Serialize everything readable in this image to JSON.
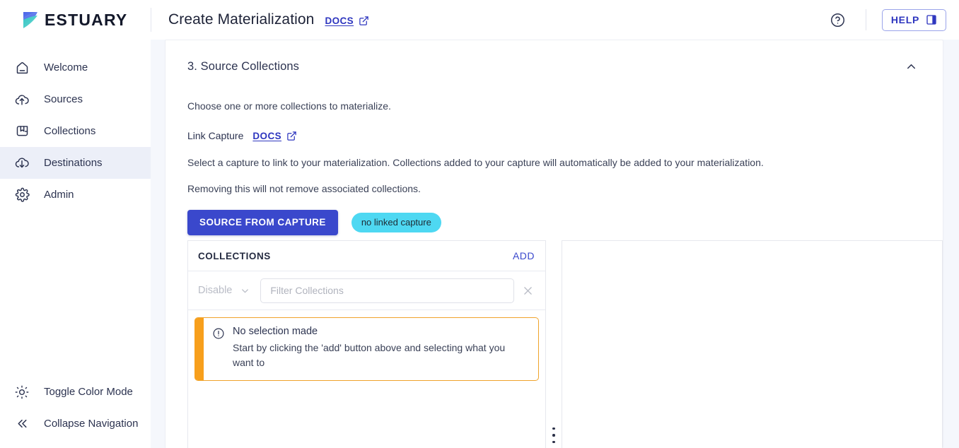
{
  "topbar": {
    "brand": "ESTUARY",
    "logo_icon": "estuary-logo-icon",
    "page_title": "Create Materialization",
    "docs_label": "DOCS",
    "docs_external_icon": "external-link-icon",
    "help_circle_icon": "help-circle-icon",
    "help_button_label": "HELP",
    "help_button_icon": "panel-open-icon"
  },
  "sidebar": {
    "items": [
      {
        "label": "Welcome",
        "icon": "home-icon",
        "active": false
      },
      {
        "label": "Sources",
        "icon": "cloud-upload-icon",
        "active": false
      },
      {
        "label": "Collections",
        "icon": "collections-icon",
        "active": false
      },
      {
        "label": "Destinations",
        "icon": "cloud-download-icon",
        "active": true
      },
      {
        "label": "Admin",
        "icon": "gear-icon",
        "active": false
      }
    ],
    "bottom_items": [
      {
        "label": "Toggle Color Mode",
        "icon": "sun-icon"
      },
      {
        "label": "Collapse Navigation",
        "icon": "chevrons-left-icon"
      }
    ]
  },
  "section": {
    "title": "3. Source Collections",
    "collapse_icon": "chevron-up-icon",
    "choose_text": "Choose one or more collections to materialize.",
    "link_capture_label": "Link Capture",
    "link_capture_docs_label": "DOCS",
    "link_capture_docs_icon": "external-link-icon",
    "select_text": "Select a capture to link to your materialization. Collections added to your capture will automatically be added to your materialization.",
    "removing_text": "Removing this will not remove associated collections.",
    "source_button_label": "SOURCE FROM CAPTURE",
    "linked_capture_chip": "no linked capture"
  },
  "collections_panel": {
    "header_title": "COLLECTIONS",
    "add_label": "ADD",
    "disable_select_value": "Disable",
    "disable_select_icon": "chevron-down-icon",
    "filter_placeholder": "Filter Collections",
    "filter_value": "",
    "clear_icon": "close-icon",
    "alert": {
      "icon": "alert-circle-icon",
      "title": "No selection made",
      "message": "Start by clicking the 'add' button above and selecting what you want to"
    }
  },
  "resize_handle": {
    "icon": "drag-handle-dots-icon"
  },
  "colors": {
    "accent_blue": "#3a48cc",
    "link_blue": "#2e36bf",
    "chip_cyan": "#4ed8f2",
    "alert_orange": "#f79f1c",
    "active_nav_bg": "#eceff8",
    "page_bg": "#f5f7fc"
  }
}
